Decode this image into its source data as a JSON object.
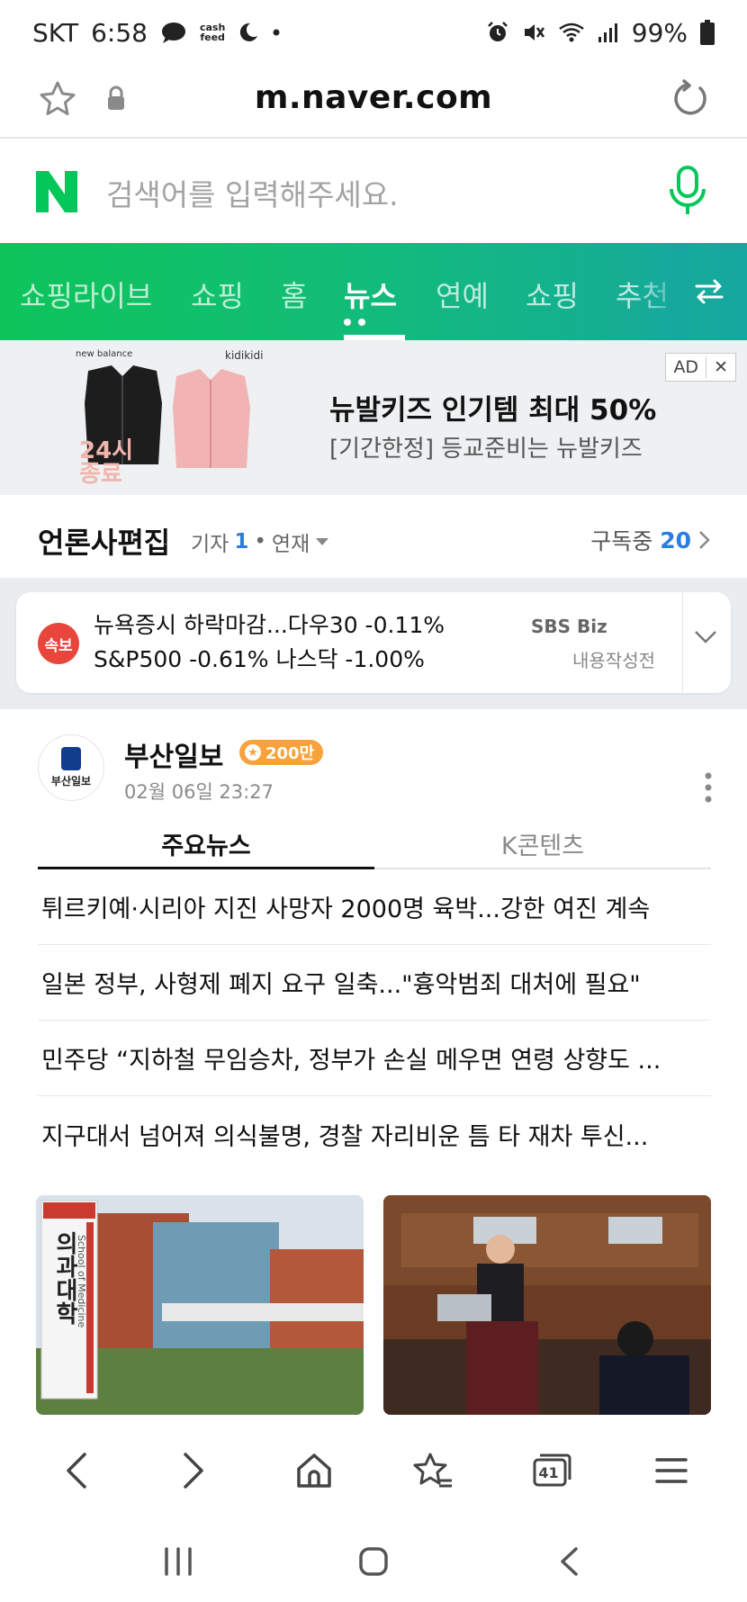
{
  "status_bar": {
    "carrier": "SKT",
    "time": "6:58",
    "cashfeed_line1": "cash",
    "cashfeed_line2": "feed",
    "battery": "99%"
  },
  "url_bar": {
    "url": "m.naver.com"
  },
  "search": {
    "logo": "N",
    "placeholder": "검색어를 입력해주세요."
  },
  "nav_tabs": [
    {
      "label": "쇼핑라이브"
    },
    {
      "label": "쇼핑"
    },
    {
      "label": "홈"
    },
    {
      "label": "뉴스",
      "active": true
    },
    {
      "label": "연예"
    },
    {
      "label": "쇼핑"
    },
    {
      "label": "추천"
    }
  ],
  "ad": {
    "brand1": "new balance",
    "brand2": "kidikidi",
    "badge_line1": "24시",
    "badge_line2": "종료",
    "title": "뉴발키즈 인기템 최대 50%",
    "subtitle": "[기간한정] 등교준비는 뉴발키즈",
    "ad_label": "AD",
    "close_label": "✕"
  },
  "press_edition": {
    "title": "언론사편집",
    "reporter_label": "기자",
    "reporter_count": "1",
    "series_label": "연재",
    "subscribed_label": "구독중",
    "subscribed_count": "20"
  },
  "breaking": {
    "badge": "속보",
    "text": "뉴욕증시 하락마감...다우30 -0.11% S&P500 -0.61% 나스닥 -1.00%",
    "source": "SBS Biz",
    "status": "내용작성전"
  },
  "press_card": {
    "logo_text": "부산일보",
    "name": "부산일보",
    "subscribers": "200만",
    "date": "02월 06일 23:27",
    "tabs": [
      {
        "label": "주요뉴스",
        "active": true
      },
      {
        "label": "K콘텐츠"
      }
    ],
    "headlines": [
      "튀르키예·시리아 지진 사망자 2000명 육박...강한 여진 계속",
      "일본 정부, 사형제 폐지 요구 일축...\"흉악범죄 대처에 필요\"",
      "민주당 “지하철 무임승차, 정부가 손실 메우면 연령 상향도 ...",
      "지구대서 넘어져 의식불명, 경찰 자리비운 틈 타 재차 투신..."
    ],
    "thumb1_sign": "의과대학",
    "thumb1_sign_en": "School of Medicine"
  },
  "bottom_nav": {
    "tabs_count": "41"
  },
  "colors": {
    "naver_green": "#03c75a",
    "accent_blue": "#2a7de1",
    "breaking_red": "#e8453c",
    "subs_orange": "#f7a23b"
  }
}
